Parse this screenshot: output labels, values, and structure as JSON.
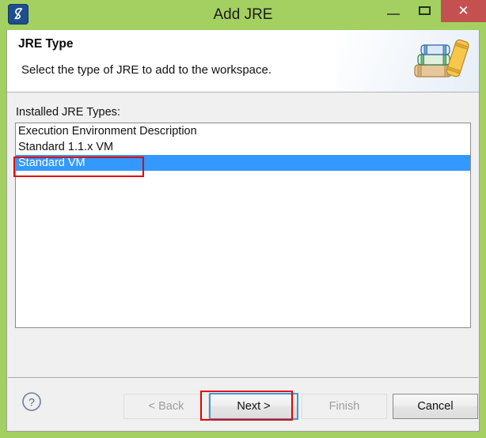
{
  "window": {
    "title": "Add JRE",
    "app_icon": "eclipse-s-icon",
    "frame_color": "#a3d060",
    "controls": {
      "minimize": "minimize-icon",
      "maximize": "maximize-icon",
      "close": "✕",
      "close_color": "#c4504f"
    }
  },
  "header": {
    "title": "JRE Type",
    "description": "Select the type of JRE to add to the workspace.",
    "icon": "books-stack-icon"
  },
  "content": {
    "label": "Installed JRE Types:",
    "list": {
      "items": [
        {
          "label": "Execution Environment Description",
          "selected": false
        },
        {
          "label": "Standard 1.1.x VM",
          "selected": false
        },
        {
          "label": "Standard VM",
          "selected": true
        }
      ],
      "selection_color": "#3399ff"
    }
  },
  "footer": {
    "help_icon": "?",
    "buttons": {
      "back": {
        "label": "< Back",
        "enabled": false
      },
      "next": {
        "label": "Next >",
        "enabled": true,
        "focused": true
      },
      "finish": {
        "label": "Finish",
        "enabled": false
      },
      "cancel": {
        "label": "Cancel",
        "enabled": true
      }
    }
  },
  "annotations": {
    "highlight_color": "#e60000",
    "boxes": [
      "standard-vm-list-item",
      "next-button"
    ]
  }
}
